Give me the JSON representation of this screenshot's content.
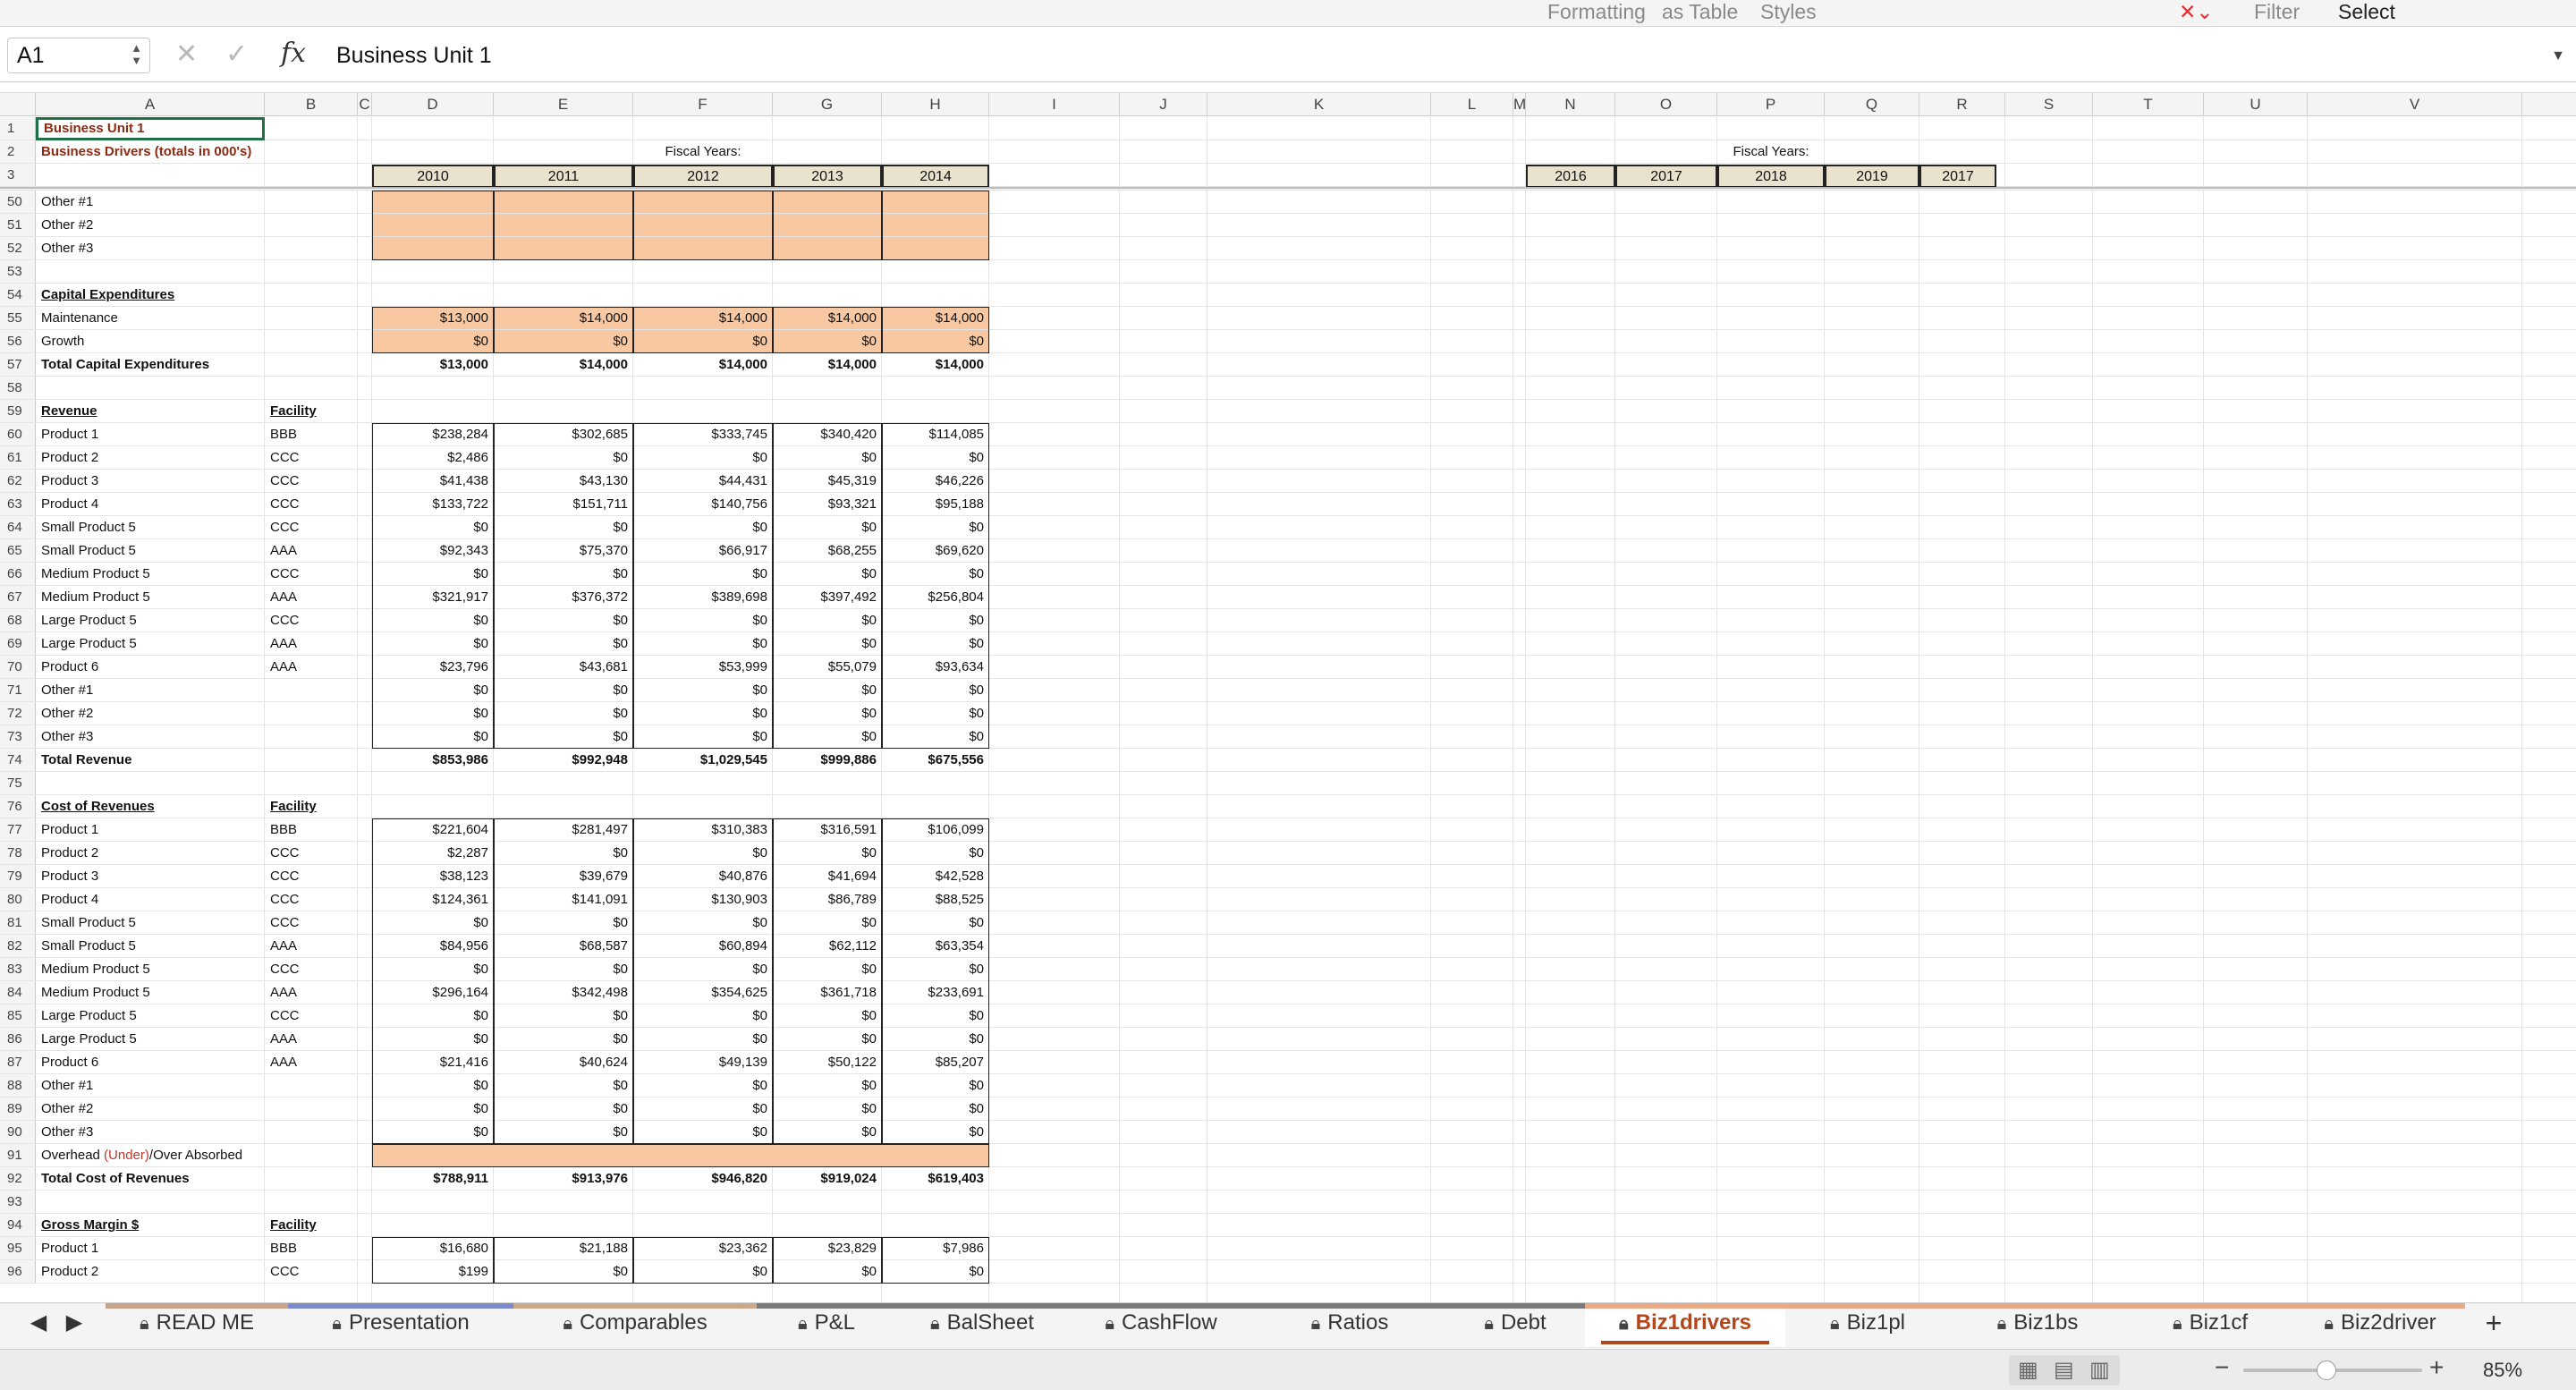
{
  "ribbon": {
    "items": [
      "Formatting",
      "as Table",
      "Styles",
      "Filter",
      "Select"
    ]
  },
  "formula_bar": {
    "name_box": "A1",
    "fx_label": "fx",
    "content": "Business Unit 1"
  },
  "columns": [
    "A",
    "B",
    "C",
    "D",
    "E",
    "F",
    "G",
    "H",
    "I",
    "J",
    "K",
    "L",
    "M",
    "N",
    "O",
    "P",
    "Q",
    "R",
    "S",
    "T",
    "U",
    "V"
  ],
  "header": {
    "title": "Business Unit 1",
    "subtitle": "Business Drivers (totals in 000's)",
    "fiscal_label": "Fiscal Years:",
    "years_left": [
      "2010",
      "2011",
      "2012",
      "2013",
      "2014"
    ],
    "years_right": [
      "2016",
      "2017",
      "2018",
      "2019",
      "2017"
    ]
  },
  "rows": [
    {
      "n": "50",
      "a": "Other #1",
      "v": [
        "",
        "",
        "",
        "",
        ""
      ]
    },
    {
      "n": "51",
      "a": "Other #2",
      "v": [
        "",
        "",
        "",
        "",
        ""
      ]
    },
    {
      "n": "52",
      "a": "Other #3",
      "v": [
        "",
        "",
        "",
        "",
        ""
      ]
    },
    {
      "n": "53",
      "a": "",
      "v": [
        "",
        "",
        "",
        "",
        ""
      ]
    },
    {
      "n": "54",
      "a": "Capital Expenditures",
      "v": [
        "",
        "",
        "",
        "",
        ""
      ]
    },
    {
      "n": "55",
      "a": "Maintenance",
      "v": [
        "$13,000",
        "$14,000",
        "$14,000",
        "$14,000",
        "$14,000"
      ]
    },
    {
      "n": "56",
      "a": "Growth",
      "v": [
        "$0",
        "$0",
        "$0",
        "$0",
        "$0"
      ]
    },
    {
      "n": "57",
      "a": "Total Capital Expenditures",
      "v": [
        "$13,000",
        "$14,000",
        "$14,000",
        "$14,000",
        "$14,000"
      ]
    },
    {
      "n": "58",
      "a": "",
      "v": [
        "",
        "",
        "",
        "",
        ""
      ]
    },
    {
      "n": "59",
      "a": "Revenue",
      "b": "Facility",
      "v": [
        "",
        "",
        "",
        "",
        ""
      ]
    },
    {
      "n": "60",
      "a": "Product 1",
      "b": "BBB",
      "v": [
        "$238,284",
        "$302,685",
        "$333,745",
        "$340,420",
        "$114,085"
      ]
    },
    {
      "n": "61",
      "a": "Product 2",
      "b": "CCC",
      "v": [
        "$2,486",
        "$0",
        "$0",
        "$0",
        "$0"
      ]
    },
    {
      "n": "62",
      "a": "Product 3",
      "b": "CCC",
      "v": [
        "$41,438",
        "$43,130",
        "$44,431",
        "$45,319",
        "$46,226"
      ]
    },
    {
      "n": "63",
      "a": "Product 4",
      "b": "CCC",
      "v": [
        "$133,722",
        "$151,711",
        "$140,756",
        "$93,321",
        "$95,188"
      ]
    },
    {
      "n": "64",
      "a": "Small Product 5",
      "b": "CCC",
      "v": [
        "$0",
        "$0",
        "$0",
        "$0",
        "$0"
      ]
    },
    {
      "n": "65",
      "a": "Small Product 5",
      "b": "AAA",
      "v": [
        "$92,343",
        "$75,370",
        "$66,917",
        "$68,255",
        "$69,620"
      ]
    },
    {
      "n": "66",
      "a": "Medium Product 5",
      "b": "CCC",
      "v": [
        "$0",
        "$0",
        "$0",
        "$0",
        "$0"
      ]
    },
    {
      "n": "67",
      "a": "Medium Product 5",
      "b": "AAA",
      "v": [
        "$321,917",
        "$376,372",
        "$389,698",
        "$397,492",
        "$256,804"
      ]
    },
    {
      "n": "68",
      "a": "Large Product 5",
      "b": "CCC",
      "v": [
        "$0",
        "$0",
        "$0",
        "$0",
        "$0"
      ]
    },
    {
      "n": "69",
      "a": "Large Product 5",
      "b": "AAA",
      "v": [
        "$0",
        "$0",
        "$0",
        "$0",
        "$0"
      ]
    },
    {
      "n": "70",
      "a": "Product 6",
      "b": "AAA",
      "v": [
        "$23,796",
        "$43,681",
        "$53,999",
        "$55,079",
        "$93,634"
      ]
    },
    {
      "n": "71",
      "a": "Other #1",
      "v": [
        "$0",
        "$0",
        "$0",
        "$0",
        "$0"
      ]
    },
    {
      "n": "72",
      "a": "Other #2",
      "v": [
        "$0",
        "$0",
        "$0",
        "$0",
        "$0"
      ]
    },
    {
      "n": "73",
      "a": "Other #3",
      "v": [
        "$0",
        "$0",
        "$0",
        "$0",
        "$0"
      ]
    },
    {
      "n": "74",
      "a": "Total Revenue",
      "v": [
        "$853,986",
        "$992,948",
        "$1,029,545",
        "$999,886",
        "$675,556"
      ]
    },
    {
      "n": "75",
      "a": "",
      "v": [
        "",
        "",
        "",
        "",
        ""
      ]
    },
    {
      "n": "76",
      "a": "Cost of Revenues",
      "b": "Facility",
      "v": [
        "",
        "",
        "",
        "",
        ""
      ]
    },
    {
      "n": "77",
      "a": "Product 1",
      "b": "BBB",
      "v": [
        "$221,604",
        "$281,497",
        "$310,383",
        "$316,591",
        "$106,099"
      ]
    },
    {
      "n": "78",
      "a": "Product 2",
      "b": "CCC",
      "v": [
        "$2,287",
        "$0",
        "$0",
        "$0",
        "$0"
      ]
    },
    {
      "n": "79",
      "a": "Product 3",
      "b": "CCC",
      "v": [
        "$38,123",
        "$39,679",
        "$40,876",
        "$41,694",
        "$42,528"
      ]
    },
    {
      "n": "80",
      "a": "Product 4",
      "b": "CCC",
      "v": [
        "$124,361",
        "$141,091",
        "$130,903",
        "$86,789",
        "$88,525"
      ]
    },
    {
      "n": "81",
      "a": "Small Product 5",
      "b": "CCC",
      "v": [
        "$0",
        "$0",
        "$0",
        "$0",
        "$0"
      ]
    },
    {
      "n": "82",
      "a": "Small Product 5",
      "b": "AAA",
      "v": [
        "$84,956",
        "$68,587",
        "$60,894",
        "$62,112",
        "$63,354"
      ]
    },
    {
      "n": "83",
      "a": "Medium Product 5",
      "b": "CCC",
      "v": [
        "$0",
        "$0",
        "$0",
        "$0",
        "$0"
      ]
    },
    {
      "n": "84",
      "a": "Medium Product 5",
      "b": "AAA",
      "v": [
        "$296,164",
        "$342,498",
        "$354,625",
        "$361,718",
        "$233,691"
      ]
    },
    {
      "n": "85",
      "a": "Large Product 5",
      "b": "CCC",
      "v": [
        "$0",
        "$0",
        "$0",
        "$0",
        "$0"
      ]
    },
    {
      "n": "86",
      "a": "Large Product 5",
      "b": "AAA",
      "v": [
        "$0",
        "$0",
        "$0",
        "$0",
        "$0"
      ]
    },
    {
      "n": "87",
      "a": "Product 6",
      "b": "AAA",
      "v": [
        "$21,416",
        "$40,624",
        "$49,139",
        "$50,122",
        "$85,207"
      ]
    },
    {
      "n": "88",
      "a": "Other #1",
      "v": [
        "$0",
        "$0",
        "$0",
        "$0",
        "$0"
      ]
    },
    {
      "n": "89",
      "a": "Other #2",
      "v": [
        "$0",
        "$0",
        "$0",
        "$0",
        "$0"
      ]
    },
    {
      "n": "90",
      "a": "Other #3",
      "v": [
        "$0",
        "$0",
        "$0",
        "$0",
        "$0"
      ]
    },
    {
      "n": "91",
      "a": "Overhead ",
      "a_red": "(Under)",
      "a_tail": "/Over Absorbed",
      "v": [
        "",
        "",
        "",
        "",
        ""
      ]
    },
    {
      "n": "92",
      "a": "Total Cost of Revenues",
      "v": [
        "$788,911",
        "$913,976",
        "$946,820",
        "$919,024",
        "$619,403"
      ]
    },
    {
      "n": "93",
      "a": "",
      "v": [
        "",
        "",
        "",
        "",
        ""
      ]
    },
    {
      "n": "94",
      "a": "Gross Margin $",
      "b": "Facility",
      "v": [
        "",
        "",
        "",
        "",
        ""
      ]
    },
    {
      "n": "95",
      "a": "Product 1",
      "b": "BBB",
      "v": [
        "$16,680",
        "$21,188",
        "$23,362",
        "$23,829",
        "$7,986"
      ]
    },
    {
      "n": "96",
      "a": "Product 2",
      "b": "CCC",
      "v": [
        "$199",
        "$0",
        "$0",
        "$0",
        "$0"
      ]
    }
  ],
  "sheet_tabs": [
    "READ ME",
    "Presentation",
    "Comparables",
    "P&L",
    "BalSheet",
    "CashFlow",
    "Ratios",
    "Debt",
    "Biz1drivers",
    "Biz1pl",
    "Biz1bs",
    "Biz1cf",
    "Biz2driver"
  ],
  "active_tab": "Biz1drivers",
  "status": {
    "zoom": "85%"
  },
  "colors": {
    "accent": "#b5451b",
    "input_fill": "#f8c8a2",
    "year_header": "#e9e2cf"
  }
}
